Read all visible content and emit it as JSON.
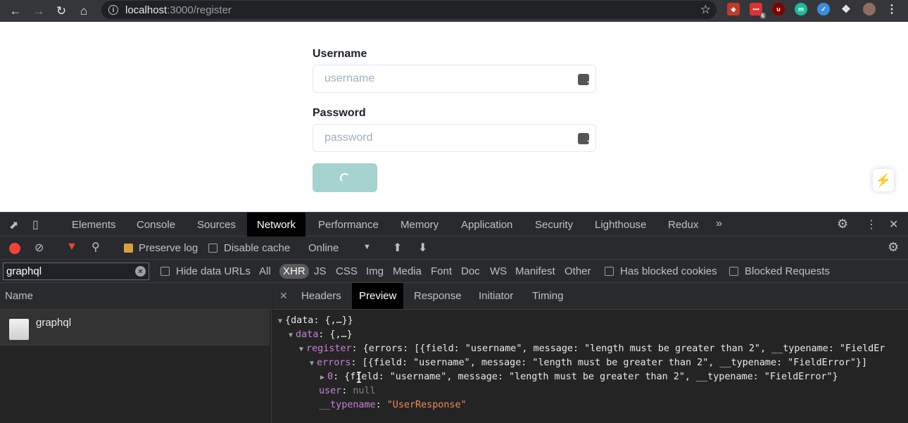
{
  "browser": {
    "url_host": "localhost",
    "url_path": ":3000/register",
    "ext_badge": "6"
  },
  "form": {
    "username_label": "Username",
    "username_placeholder": "username",
    "password_label": "Password",
    "password_placeholder": "password"
  },
  "devtools": {
    "tabs": [
      "Elements",
      "Console",
      "Sources",
      "Network",
      "Performance",
      "Memory",
      "Application",
      "Security",
      "Lighthouse",
      "Redux"
    ],
    "active_tab": "Network",
    "toolbar": {
      "preserve_log": "Preserve log",
      "disable_cache": "Disable cache",
      "throttle": "Online"
    },
    "filter": {
      "value": "graphql",
      "hide_data_urls": "Hide data URLs",
      "types": [
        "All",
        "XHR",
        "JS",
        "CSS",
        "Img",
        "Media",
        "Font",
        "Doc",
        "WS",
        "Manifest",
        "Other"
      ],
      "active_type": "XHR",
      "has_blocked_cookies": "Has blocked cookies",
      "blocked_requests": "Blocked Requests"
    },
    "name_header": "Name",
    "request_name": "graphql",
    "detail_tabs": [
      "Headers",
      "Preview",
      "Response",
      "Initiator",
      "Timing"
    ],
    "active_detail_tab": "Preview",
    "preview": {
      "line1": "{data: {,…}}",
      "line2_key": "data",
      "line2_val": "{,…}",
      "line3_key": "register",
      "line3_val": "{errors: [{field: \"username\", message: \"length must be greater than 2\", __typename: \"FieldEr",
      "line4_key": "errors",
      "line4_val": "[{field: \"username\", message: \"length must be greater than 2\", __typename: \"FieldError\"}]",
      "line5_key": "0",
      "line5_val": "{field: \"username\", message: \"length must be greater than 2\", __typename: \"FieldError\"}",
      "line6_key": "user",
      "line6_val": "null",
      "line7_key": "__typename",
      "line7_val": "\"UserResponse\""
    }
  }
}
